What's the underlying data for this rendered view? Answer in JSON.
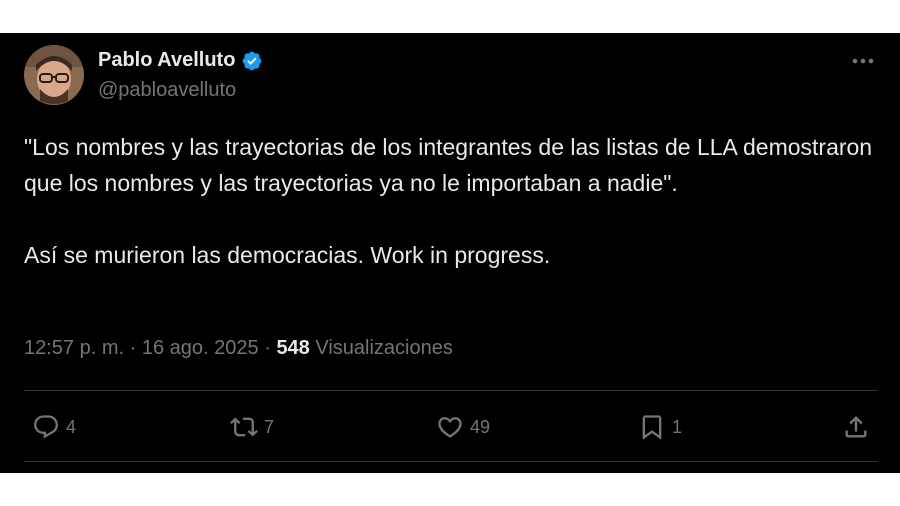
{
  "author": {
    "name": "Pablo Avelluto",
    "handle": "@pabloavelluto",
    "verified_color": "#1d9bf0"
  },
  "tweet": {
    "paragraphs": [
      "\"Los nombres y las trayectorias de los integrantes de las listas de LLA demostraron que los nombres y las trayectorias ya no le importaban a nadie\".",
      "Así se murieron las democracias. Work in progress."
    ]
  },
  "meta": {
    "time": "12:57 p. m.",
    "separator": "·",
    "date": "16 ago. 2025",
    "views_count": "548",
    "views_label": "Visualizaciones"
  },
  "actions": {
    "reply_count": "4",
    "retweet_count": "7",
    "like_count": "49",
    "bookmark_count": "1"
  },
  "icons": [
    "avatar",
    "verified-icon",
    "more-icon",
    "reply-icon",
    "retweet-icon",
    "like-icon",
    "bookmark-icon",
    "share-icon"
  ],
  "colors": {
    "background": "#000000",
    "text": "#e7e9ea",
    "muted": "#71767b",
    "divider": "#2f3336"
  }
}
